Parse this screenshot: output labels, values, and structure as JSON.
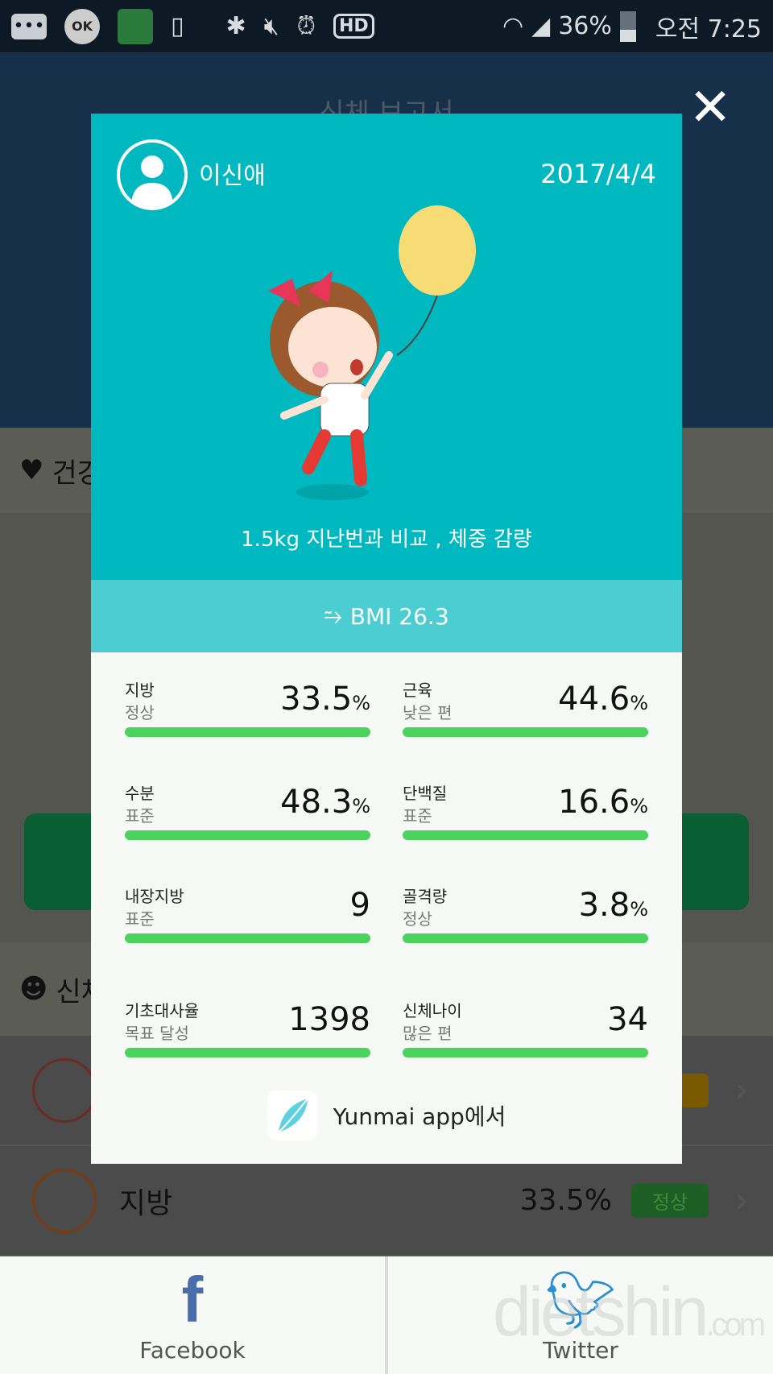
{
  "status_bar": {
    "battery": "36%",
    "time": "오전 7:25",
    "icons": [
      "more-icon",
      "ok-cashbag-icon",
      "app-notification-icon",
      "screen-mirror-icon",
      "bluetooth-icon",
      "mute-vibrate-icon",
      "alarm-icon",
      "hd-voice-icon",
      "wifi-icon",
      "signal-icon",
      "battery-icon"
    ]
  },
  "background": {
    "title": "신체 보고서",
    "section1": "건강",
    "section2": "신체",
    "list": [
      {
        "name": "",
        "value": "",
        "badge": "",
        "icon": "trend-icon"
      },
      {
        "name": "지방",
        "value": "33.5%",
        "badge": "정상",
        "icon": "dna-icon"
      }
    ]
  },
  "modal": {
    "user_name": "이신애",
    "date": "2017/4/4",
    "message": "1.5kg 지난번과 비교 , 체중 감량",
    "bmi": "BMI 26.3",
    "stats": [
      {
        "label": "지방",
        "status": "정상",
        "value": "33.5",
        "unit": "%",
        "fill": 1.0
      },
      {
        "label": "근육",
        "status": "낮은 편",
        "value": "44.6",
        "unit": "%",
        "fill": 1.0
      },
      {
        "label": "수분",
        "status": "표준",
        "value": "48.3",
        "unit": "%",
        "fill": 1.0
      },
      {
        "label": "단백질",
        "status": "표준",
        "value": "16.6",
        "unit": "%",
        "fill": 1.0
      },
      {
        "label": "내장지방",
        "status": "표준",
        "value": "9",
        "unit": "",
        "fill": 1.0
      },
      {
        "label": "골격량",
        "status": "정상",
        "value": "3.8",
        "unit": "%",
        "fill": 1.0
      },
      {
        "label": "기초대사율",
        "status": "목표 달성",
        "value": "1398",
        "unit": "",
        "fill": 1.0
      },
      {
        "label": "신체나이",
        "status": "많은 편",
        "value": "34",
        "unit": "",
        "fill": 1.0
      }
    ],
    "footer": "Yunmai app에서"
  },
  "share": {
    "facebook": "Facebook",
    "twitter": "Twitter"
  },
  "watermark": "dietshin.com",
  "colors": {
    "teal": "#00b8bf",
    "bmi_bar": "#4ccdd2",
    "progress": "#4cd35e",
    "facebook": "#4a6eab",
    "twitter": "#2a8fd0"
  }
}
